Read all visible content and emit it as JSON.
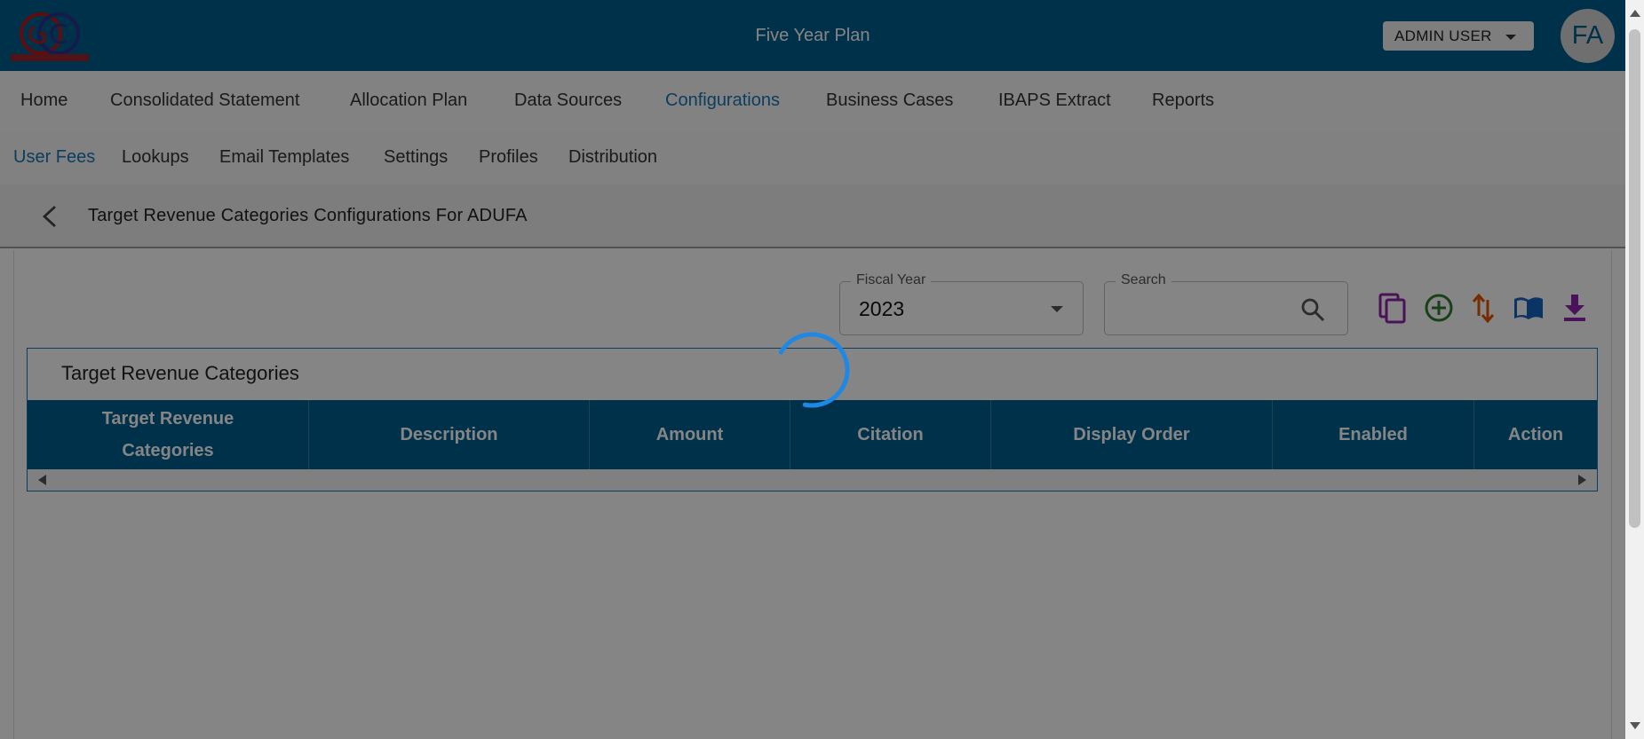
{
  "header": {
    "app_title": "Five Year Plan",
    "user_menu_label": "ADMIN USER",
    "avatar_initials": "FA",
    "logo_text": "GOV CONNECT INC",
    "brand_color": "#005f8f"
  },
  "nav": {
    "items": [
      {
        "label": "Home",
        "active": false
      },
      {
        "label": "Consolidated Statement",
        "active": false
      },
      {
        "label": "Allocation Plan",
        "active": false
      },
      {
        "label": "Data Sources",
        "active": false
      },
      {
        "label": "Configurations",
        "active": true
      },
      {
        "label": "Business Cases",
        "active": false
      },
      {
        "label": "IBAPS Extract",
        "active": false
      },
      {
        "label": "Reports",
        "active": false
      }
    ]
  },
  "subnav": {
    "items": [
      {
        "label": "User Fees",
        "active": true
      },
      {
        "label": "Lookups",
        "active": false
      },
      {
        "label": "Email Templates",
        "active": false
      },
      {
        "label": "Settings",
        "active": false
      },
      {
        "label": "Profiles",
        "active": false
      },
      {
        "label": "Distribution",
        "active": false
      }
    ]
  },
  "page": {
    "title": "Target Revenue Categories Configurations For ADUFA"
  },
  "filters": {
    "fiscal_year_label": "Fiscal Year",
    "fiscal_year_value": "2023",
    "search_label": "Search",
    "search_value": ""
  },
  "toolbar": {
    "icons": [
      {
        "name": "copy-icon",
        "color": "#8e24aa"
      },
      {
        "name": "add-circle-icon",
        "color": "#2e7d32"
      },
      {
        "name": "sort-icon",
        "color": "#e65100"
      },
      {
        "name": "book-icon",
        "color": "#1565c0"
      },
      {
        "name": "download-icon",
        "color": "#8e24aa"
      }
    ]
  },
  "table": {
    "title": "Target Revenue Categories",
    "columns": [
      "Target Revenue Categories",
      "Description",
      "Amount",
      "Citation",
      "Display Order",
      "Enabled",
      "Action"
    ],
    "rows": []
  },
  "status": {
    "loading": true,
    "spinner_color": "#1e88e5"
  }
}
